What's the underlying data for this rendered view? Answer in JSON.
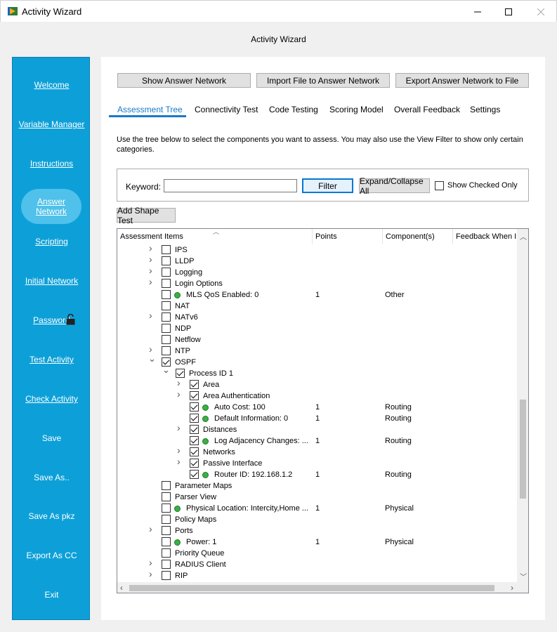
{
  "window": {
    "title": "Activity Wizard",
    "header": "Activity Wizard"
  },
  "sidebar": {
    "items": [
      {
        "label": "Welcome",
        "underline_first": true
      },
      {
        "label": "Variable Manager",
        "underline_first": true
      },
      {
        "label": "Instructions",
        "underline_first": true
      },
      {
        "label": "Answer Network",
        "underline_first": true,
        "active": true
      },
      {
        "label": "Scripting",
        "underline_first": true
      },
      {
        "label": "Initial Network",
        "underline_first": true
      },
      {
        "label": "Password",
        "underline_first": true
      },
      {
        "label": "Test Activity",
        "underline_first": true
      },
      {
        "label": "Check Activity",
        "underline_first": true
      },
      {
        "label": "Save"
      },
      {
        "label": "Save As.."
      },
      {
        "label": "Save As pkz"
      },
      {
        "label": "Export As CC"
      },
      {
        "label": "Exit"
      }
    ]
  },
  "toolbar": {
    "show_answer": "Show Answer Network",
    "import_file": "Import File to Answer Network",
    "export_file": "Export Answer Network to File"
  },
  "tabs": [
    "Assessment Tree",
    "Connectivity Test",
    "Code Testing",
    "Scoring Model",
    "Overall Feedback",
    "Settings"
  ],
  "description": "Use the tree below to select the components you want to assess. You may also use the View Filter to show only certain categories.",
  "filter": {
    "keyword_label": "Keyword:",
    "keyword_value": "",
    "filter_button": "Filter",
    "expand_button": "Expand/Collapse All",
    "show_checked_label": "Show Checked Only"
  },
  "add_shape_test": "Add Shape Test",
  "tree": {
    "columns": [
      "Assessment Items",
      "Points",
      "Component(s)",
      "Feedback When In"
    ],
    "rows": [
      {
        "level": 0,
        "exp": "r",
        "checked": false,
        "dot": false,
        "label": "IPS",
        "points": "",
        "component": ""
      },
      {
        "level": 0,
        "exp": "r",
        "checked": false,
        "dot": false,
        "label": "LLDP",
        "points": "",
        "component": ""
      },
      {
        "level": 0,
        "exp": "r",
        "checked": false,
        "dot": false,
        "label": "Logging",
        "points": "",
        "component": ""
      },
      {
        "level": 0,
        "exp": "r",
        "checked": false,
        "dot": false,
        "label": "Login Options",
        "points": "",
        "component": ""
      },
      {
        "level": 0,
        "exp": "",
        "checked": false,
        "dot": true,
        "label": "MLS QoS Enabled: 0",
        "points": "1",
        "component": "Other"
      },
      {
        "level": 0,
        "exp": "",
        "checked": false,
        "dot": false,
        "label": "NAT",
        "points": "",
        "component": ""
      },
      {
        "level": 0,
        "exp": "r",
        "checked": false,
        "dot": false,
        "label": "NATv6",
        "points": "",
        "component": ""
      },
      {
        "level": 0,
        "exp": "",
        "checked": false,
        "dot": false,
        "label": "NDP",
        "points": "",
        "component": ""
      },
      {
        "level": 0,
        "exp": "",
        "checked": false,
        "dot": false,
        "label": "Netflow",
        "points": "",
        "component": ""
      },
      {
        "level": 0,
        "exp": "r",
        "checked": false,
        "dot": false,
        "label": "NTP",
        "points": "",
        "component": ""
      },
      {
        "level": 0,
        "exp": "d",
        "checked": true,
        "dot": false,
        "label": "OSPF",
        "points": "",
        "component": ""
      },
      {
        "level": 1,
        "exp": "d",
        "checked": true,
        "dot": false,
        "label": "Process ID 1",
        "points": "",
        "component": ""
      },
      {
        "level": 2,
        "exp": "r",
        "checked": true,
        "dot": false,
        "label": "Area",
        "points": "",
        "component": ""
      },
      {
        "level": 2,
        "exp": "r",
        "checked": true,
        "dot": false,
        "label": "Area Authentication",
        "points": "",
        "component": ""
      },
      {
        "level": 2,
        "exp": "",
        "checked": true,
        "dot": true,
        "label": "Auto Cost: 100",
        "points": "1",
        "component": "Routing"
      },
      {
        "level": 2,
        "exp": "",
        "checked": true,
        "dot": true,
        "label": "Default Information: 0",
        "points": "1",
        "component": "Routing"
      },
      {
        "level": 2,
        "exp": "r",
        "checked": true,
        "dot": false,
        "label": "Distances",
        "points": "",
        "component": ""
      },
      {
        "level": 2,
        "exp": "",
        "checked": true,
        "dot": true,
        "label": "Log Adjacency Changes: ...",
        "points": "1",
        "component": "Routing"
      },
      {
        "level": 2,
        "exp": "r",
        "checked": true,
        "dot": false,
        "label": "Networks",
        "points": "",
        "component": ""
      },
      {
        "level": 2,
        "exp": "r",
        "checked": true,
        "dot": false,
        "label": "Passive Interface",
        "points": "",
        "component": ""
      },
      {
        "level": 2,
        "exp": "",
        "checked": true,
        "dot": true,
        "label": "Router ID: 192.168.1.2",
        "points": "1",
        "component": "Routing"
      },
      {
        "level": 0,
        "exp": "",
        "checked": false,
        "dot": false,
        "label": "Parameter Maps",
        "points": "",
        "component": ""
      },
      {
        "level": 0,
        "exp": "",
        "checked": false,
        "dot": false,
        "label": "Parser View",
        "points": "",
        "component": ""
      },
      {
        "level": 0,
        "exp": "",
        "checked": false,
        "dot": true,
        "label": "Physical Location: Intercity,Home ...",
        "points": "1",
        "component": "Physical"
      },
      {
        "level": 0,
        "exp": "",
        "checked": false,
        "dot": false,
        "label": "Policy Maps",
        "points": "",
        "component": ""
      },
      {
        "level": 0,
        "exp": "r",
        "checked": false,
        "dot": false,
        "label": "Ports",
        "points": "",
        "component": ""
      },
      {
        "level": 0,
        "exp": "",
        "checked": false,
        "dot": true,
        "label": "Power: 1",
        "points": "1",
        "component": "Physical"
      },
      {
        "level": 0,
        "exp": "",
        "checked": false,
        "dot": false,
        "label": "Priority Queue",
        "points": "",
        "component": ""
      },
      {
        "level": 0,
        "exp": "r",
        "checked": false,
        "dot": false,
        "label": "RADIUS Client",
        "points": "",
        "component": ""
      },
      {
        "level": 0,
        "exp": "r",
        "checked": false,
        "dot": false,
        "label": "RIP",
        "points": "",
        "component": ""
      }
    ]
  },
  "colors": {
    "sidebar": "#0da0d8",
    "active_nav": "#4fc1ea",
    "tab_accent": "#1979ca",
    "status_dot": "#3cb043"
  }
}
